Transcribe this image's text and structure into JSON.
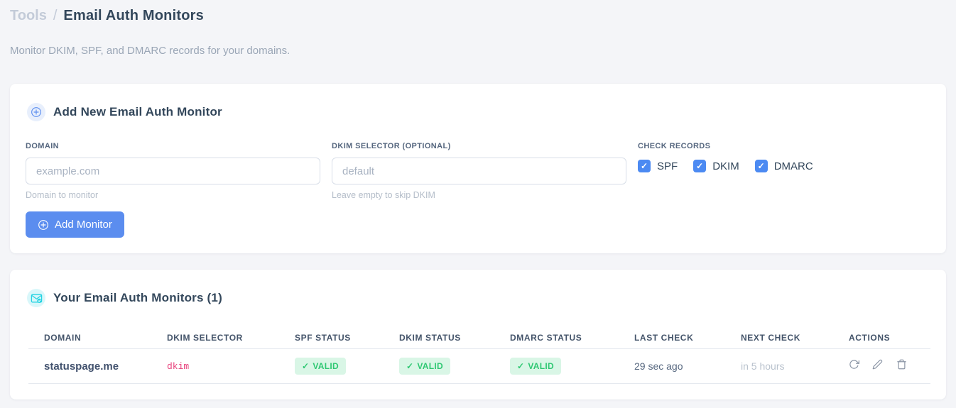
{
  "header": {
    "breadcrumb_section": "Tools",
    "breadcrumb_separator": "/",
    "title": "Email Auth Monitors",
    "subtitle": "Monitor DKIM, SPF, and DMARC records for your domains."
  },
  "add_monitor_card": {
    "title": "Add New Email Auth Monitor",
    "domain_field": {
      "label": "DOMAIN",
      "placeholder": "example.com",
      "value": "",
      "helper": "Domain to monitor"
    },
    "dkim_field": {
      "label": "DKIM SELECTOR (OPTIONAL)",
      "placeholder": "default",
      "value": "",
      "helper": "Leave empty to skip DKIM"
    },
    "check_records": {
      "label": "CHECK RECORDS",
      "options": [
        {
          "label": "SPF",
          "checked": true
        },
        {
          "label": "DKIM",
          "checked": true
        },
        {
          "label": "DMARC",
          "checked": true
        }
      ]
    },
    "submit_label": "Add Monitor"
  },
  "monitors_card": {
    "title": "Your Email Auth Monitors (1)",
    "count": 1,
    "table": {
      "columns": [
        "DOMAIN",
        "DKIM SELECTOR",
        "SPF STATUS",
        "DKIM STATUS",
        "DMARC STATUS",
        "LAST CHECK",
        "NEXT CHECK",
        "ACTIONS"
      ],
      "rows": [
        {
          "domain": "statuspage.me",
          "dkim_selector": "dkim",
          "spf_status": "VALID",
          "dkim_status": "VALID",
          "dmarc_status": "VALID",
          "last_check": "29 sec ago",
          "next_check": "in 5 hours",
          "actions": [
            "refresh",
            "edit",
            "delete"
          ]
        }
      ]
    }
  },
  "icons": {
    "check": "✓",
    "plus_circle": "plus-circle-icon",
    "mail_check": "mail-check-icon",
    "refresh": "refresh-icon",
    "edit": "pencil-icon",
    "delete": "trash-icon"
  },
  "colors": {
    "accent_blue": "#5b8def",
    "checkbox_blue": "#4c8af2",
    "accent_cyan": "#25d3e2",
    "badge_green_bg": "#d9f6e6",
    "badge_green_text": "#2fc873",
    "code_pink": "#e8427c",
    "page_bg": "#f4f5f8"
  }
}
